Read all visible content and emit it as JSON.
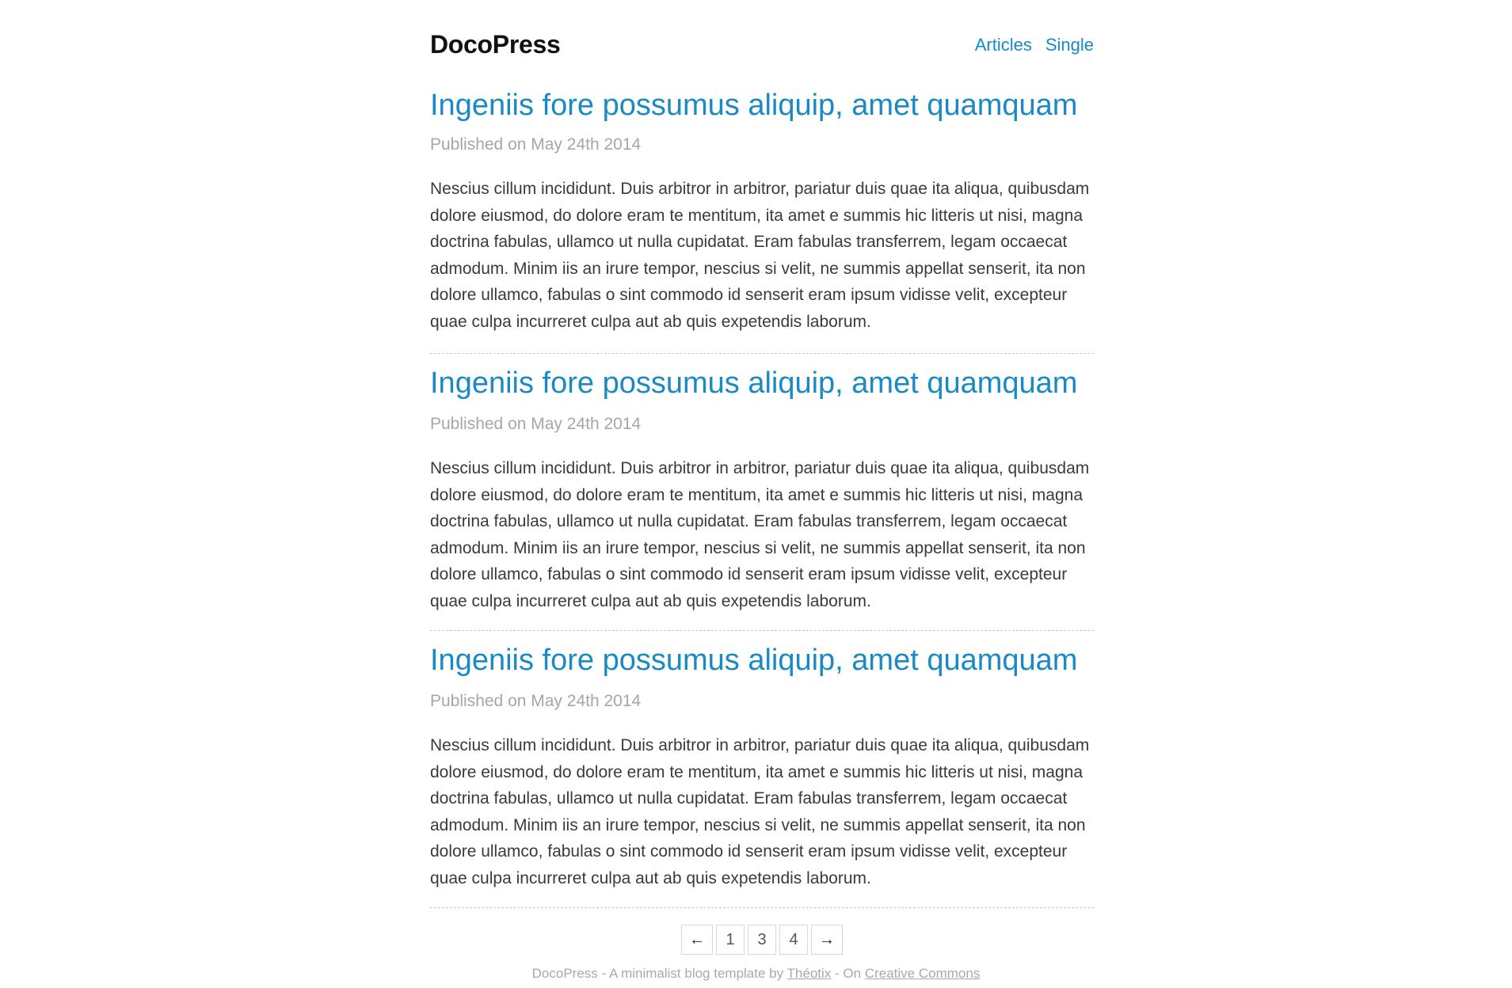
{
  "header": {
    "site_title": "DocoPress",
    "nav": [
      {
        "label": "Articles"
      },
      {
        "label": "Single"
      }
    ]
  },
  "articles": [
    {
      "title": "Ingeniis fore possumus aliquip, amet quamquam",
      "date": "Published on May 24th 2014",
      "body": "Nescius cillum incididunt. Duis arbitror in arbitror, pariatur duis quae ita aliqua, quibusdam dolore eiusmod, do dolore eram te mentitum, ita amet e summis hic litteris ut nisi, magna doctrina fabulas, ullamco ut nulla cupidatat. Eram fabulas transferrem, legam occaecat admodum. Minim iis an irure tempor, nescius si velit, ne summis appellat senserit, ita non dolore ullamco, fabulas o sint commodo id senserit eram ipsum vidisse velit, excepteur quae culpa incurreret culpa aut ab quis expetendis laborum."
    },
    {
      "title": "Ingeniis fore possumus aliquip, amet quamquam",
      "date": "Published on May 24th 2014",
      "body": "Nescius cillum incididunt. Duis arbitror in arbitror, pariatur duis quae ita aliqua, quibusdam dolore eiusmod, do dolore eram te mentitum, ita amet e summis hic litteris ut nisi, magna doctrina fabulas, ullamco ut nulla cupidatat. Eram fabulas transferrem, legam occaecat admodum. Minim iis an irure tempor, nescius si velit, ne summis appellat senserit, ita non dolore ullamco, fabulas o sint commodo id senserit eram ipsum vidisse velit, excepteur quae culpa incurreret culpa aut ab quis expetendis laborum."
    },
    {
      "title": "Ingeniis fore possumus aliquip, amet quamquam",
      "date": "Published on May 24th 2014",
      "body": "Nescius cillum incididunt. Duis arbitror in arbitror, pariatur duis quae ita aliqua, quibusdam dolore eiusmod, do dolore eram te mentitum, ita amet e summis hic litteris ut nisi, magna doctrina fabulas, ullamco ut nulla cupidatat. Eram fabulas transferrem, legam occaecat admodum. Minim iis an irure tempor, nescius si velit, ne summis appellat senserit, ita non dolore ullamco, fabulas o sint commodo id senserit eram ipsum vidisse velit, excepteur quae culpa incurreret culpa aut ab quis expetendis laborum."
    }
  ],
  "pagination": {
    "prev": "←",
    "pages": [
      "1",
      "3",
      "4"
    ],
    "next": "→"
  },
  "footer": {
    "text_before": "DocoPress - A minimalist blog template by",
    "author_link": "Théotix",
    "text_middle": "- On",
    "license_link": "Creative Commons"
  },
  "colors": {
    "accent": "#1a8ac5",
    "text": "#3a3a3a",
    "muted": "#a6a6a6"
  }
}
